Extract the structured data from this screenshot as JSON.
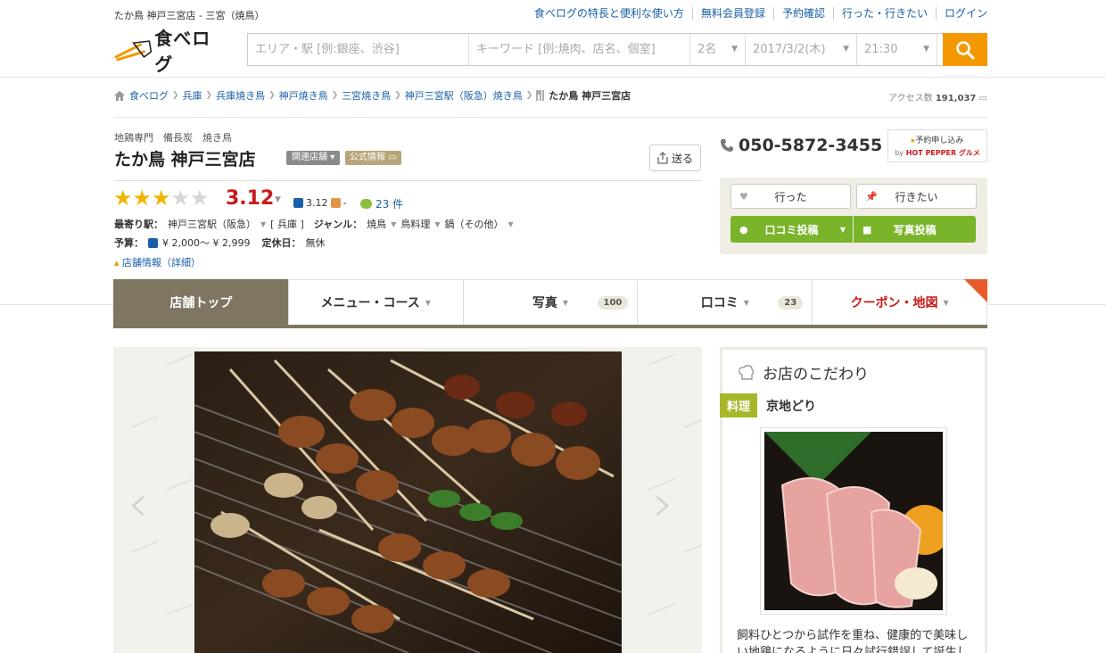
{
  "header": {
    "page_title": "たか鳥 神戸三宮店 - 三宮（焼鳥）",
    "nav_links": [
      "食べログの特長と便利な使い方",
      "無料会員登録",
      "予約確認",
      "行った・行きたい",
      "ログイン"
    ],
    "logo_text": "食べログ"
  },
  "search": {
    "area_placeholder": "エリア・駅 [例:銀座、渋谷]",
    "keyword_placeholder": "キーワード [例:焼肉、店名、個室]",
    "people": "2名",
    "date": "2017/3/2(木)",
    "time": "21:30",
    "button_icon": "search-icon"
  },
  "breadcrumb": {
    "items": [
      "食べログ",
      "兵庫",
      "兵庫焼き鳥",
      "神戸焼き鳥",
      "三宮焼き鳥",
      "神戸三宮駅（阪急）焼き鳥"
    ],
    "current": "たか鳥 神戸三宮店"
  },
  "access": {
    "label": "アクセス数",
    "count": "191,037"
  },
  "store": {
    "subcategory": "地鶏専門　備長炭　焼き鳥",
    "name": "たか鳥 神戸三宮店",
    "badge_related": "関連店舗",
    "badge_official": "公式情報",
    "send_label": "送る",
    "rating": "3.12",
    "stars": 3,
    "rating_small": "3.12",
    "rating_small_suffix": "-",
    "review_count": "23 件",
    "station_label": "最寄り駅：",
    "station": "神戸三宮駅（阪急）",
    "pref": "[ 兵庫 ]",
    "genre_label": "ジャンル：",
    "genres": [
      "焼鳥",
      "鳥料理",
      "鍋（その他）"
    ],
    "budget_label": "予算：",
    "budget": "¥ 2,000～ ¥ 2,999",
    "holiday_label": "定休日：",
    "holiday": "無休",
    "detail_link": "店舗情報（詳細）"
  },
  "actions": {
    "phone": "050-5872-3455",
    "reserve_label": "予約申し込み",
    "reserve_by": "by",
    "reserve_brand": "HOT PEPPER グルメ",
    "went_label": "行った",
    "want_label": "行きたい",
    "review_label": "口コミ投稿",
    "photo_label": "写真投稿"
  },
  "tabs": [
    {
      "label": "店舗トップ",
      "count": ""
    },
    {
      "label": "メニュー・コース",
      "count": ""
    },
    {
      "label": "写真",
      "count": "100"
    },
    {
      "label": "口コミ",
      "count": "23"
    },
    {
      "label": "クーポン・地図",
      "count": ""
    }
  ],
  "kodawari": {
    "title": "お店のこだわり",
    "tag": "料理",
    "item_name": "京地どり",
    "text": "飼料ひとつから試作を重ね、健康的で美味しい地鶏になるように日々試行錯誤して誕生し"
  },
  "colors": {
    "brand_orange": "#f39800",
    "tab_active": "#7e7660",
    "rating_red": "#c81a1a",
    "action_green": "#7ab42a",
    "link_blue": "#1a5fa8"
  }
}
